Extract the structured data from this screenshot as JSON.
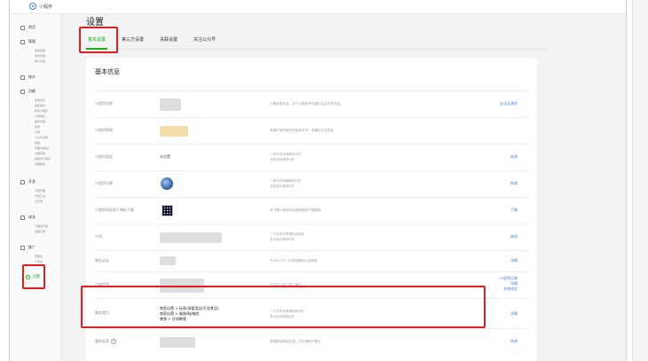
{
  "app": {
    "name": "小程序"
  },
  "sidebar": {
    "groups": [
      {
        "label": "首页",
        "subs": []
      },
      {
        "label": "管理",
        "subs": [
          "版本管理",
          "成员管理",
          "用户反馈"
        ]
      },
      {
        "label": "统计",
        "subs": []
      },
      {
        "label": "功能",
        "subs": [
          "客服消息",
          "模板消息",
          "附近小程序",
          "订阅消息",
          "插件管理",
          "搜索",
          "订单",
          "公众号关联",
          "直播",
          "页面内容接入",
          "小程序码",
          "视频号小程序",
          "页面路径"
        ]
      },
      {
        "label": "开发",
        "subs": [
          "开发管理",
          "开发工具",
          "云开发"
        ]
      },
      {
        "label": "成长",
        "subs": [
          "小程序评测",
          "违规记录"
        ]
      },
      {
        "label": "推广",
        "subs": [
          "流量主",
          "广告主"
        ]
      }
    ],
    "active": "设置"
  },
  "page": {
    "title": "设置"
  },
  "tabs": [
    {
      "label": "基本设置",
      "active": true
    },
    {
      "label": "第三方设置",
      "active": false
    },
    {
      "label": "关联设置",
      "active": false
    },
    {
      "label": "关注公众号",
      "active": false
    }
  ],
  "card": {
    "title": "基本信息"
  },
  "rows": [
    {
      "label": "小程序名称",
      "desc": "小程序发布后，非个人类帐号可通过认证方式改名。",
      "action": "去认证改名"
    },
    {
      "label": "小程序简称",
      "desc": "来源于你的帐号的名称字符，或通过认证改名",
      "action": ""
    },
    {
      "label": "小程序类型",
      "value": "未设置",
      "desc": [
        "一年内可申请修改3次",
        "今年还可修改3次"
      ],
      "action": "修改"
    },
    {
      "label": "小程序头像",
      "desc": [
        "一年内可申请修改5次",
        "今年还可修改5次"
      ],
      "action": "修改"
    },
    {
      "label": "小程序码及线下物料下载",
      "desc": "可下载小程序码及推荐物料下载物料",
      "action": "下载"
    },
    {
      "label": "介绍",
      "desc": [
        "一个月内可申请5次修改",
        "本月还可修改5次"
      ],
      "action": "修改"
    },
    {
      "label": "微信认证",
      "desc": "于2017-07-14完成微信认证审核",
      "action": "详情"
    },
    {
      "label": "主体信息",
      "desc": "企业法人及个体工商户",
      "action": [
        "小程序迁移",
        "详情",
        "名称核定"
      ]
    },
    {
      "label": "服务类目",
      "categories": [
        "商家自营 > 玩具/母婴用品(不含食品)",
        "商家自营 > 服装/鞋/箱包",
        "教育 > 在线教育"
      ],
      "desc": [
        "一个月内可申请修改3次",
        "本月还可修改3次"
      ],
      "action": "详情"
    },
    {
      "label": "服务标签",
      "desc": "根据服务类目生成，供口碑用户展示",
      "action": "修改"
    }
  ],
  "colors": {
    "accent": "#1aad19",
    "link": "#3b7bd6",
    "highlight": "#e02020"
  }
}
